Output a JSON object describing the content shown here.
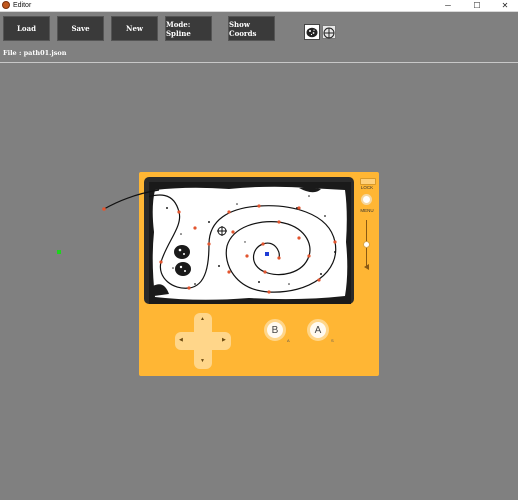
{
  "window": {
    "title": "Editor",
    "minimize_glyph": "─",
    "maximize_glyph": "☐",
    "close_glyph": "✕"
  },
  "toolbar": {
    "load_label": "Load",
    "save_label": "Save",
    "new_label": "New",
    "mode_label": "Mode: Spline",
    "coords_label": "Show Coords",
    "tools": [
      "rock-icon",
      "move-icon"
    ]
  },
  "file": {
    "label": "File : path01.json"
  },
  "device": {
    "lock_label": "LOCK",
    "menu_label": "MENU",
    "b_label": "B",
    "a_label": "A",
    "b_sub": "A",
    "a_sub": "S",
    "icons": [
      "dpad-up-icon",
      "dpad-down-icon",
      "dpad-left-icon",
      "dpad-right-icon",
      "crank-arrow-icon"
    ]
  },
  "colors": {
    "background": "#808080",
    "device": "#ffb634",
    "path_node": "#e2552f",
    "selected_node": "#1f3dd6",
    "origin_marker": "#1ed41e"
  }
}
